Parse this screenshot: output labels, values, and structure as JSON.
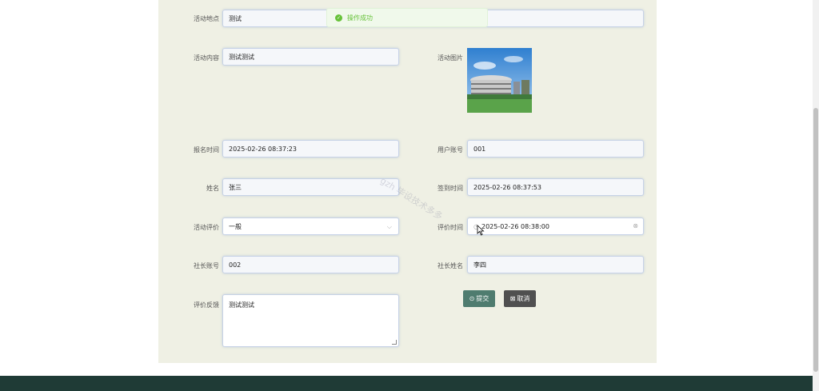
{
  "toast": {
    "message": "操作成功",
    "icon": "check-circle-icon",
    "color": "#67c23a"
  },
  "form": {
    "location": {
      "label": "活动地点",
      "value": "测试"
    },
    "content": {
      "label": "活动内容",
      "value": "测试测试"
    },
    "image": {
      "label": "活动图片"
    },
    "signup_time": {
      "label": "报名时间",
      "value": "2025-02-26 08:37:23"
    },
    "user_account": {
      "label": "用户账号",
      "value": "001"
    },
    "name": {
      "label": "姓名",
      "value": "张三"
    },
    "checkin_time": {
      "label": "签到时间",
      "value": "2025-02-26 08:37:53"
    },
    "rating": {
      "label": "活动评价",
      "value": "一般"
    },
    "rating_time": {
      "label": "评价时间",
      "value": "2025-02-26 08:38:00"
    },
    "leader_account": {
      "label": "社长账号",
      "value": "002"
    },
    "leader_name": {
      "label": "社长姓名",
      "value": "李四"
    },
    "feedback": {
      "label": "评价反馈",
      "value": "测试测试"
    }
  },
  "buttons": {
    "submit": "提交",
    "cancel": "取消"
  },
  "watermark": "gzh 毕设技术多多",
  "colors": {
    "panel": "#eff0e4",
    "footer": "#1f3b36",
    "submit": "#4f7c6f",
    "cancel": "#505050"
  }
}
